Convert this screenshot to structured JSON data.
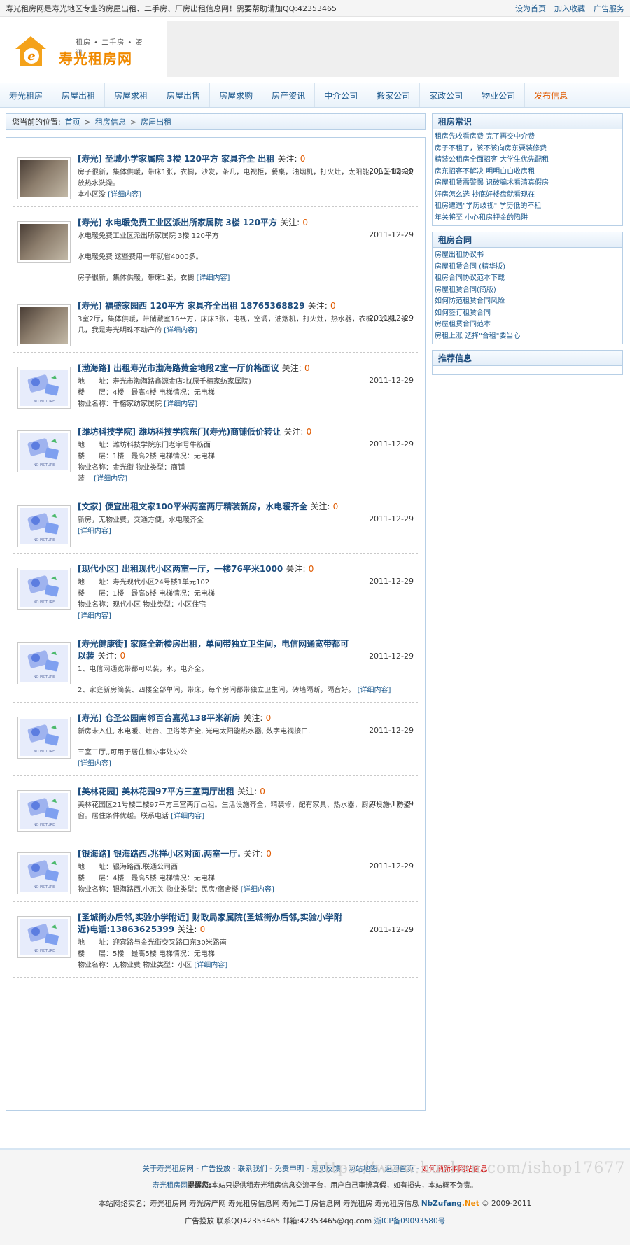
{
  "topbar": {
    "intro": "寿光租房网是寿光地区专业的房屋出租、二手房、厂房出租信息网！需要帮助请加QQ:42353465",
    "links": [
      "设为首页",
      "加入收藏",
      "广告服务"
    ]
  },
  "logo": {
    "tags": "租房 • 二手房 • 资讯",
    "name": "寿光租房网"
  },
  "nav": [
    "寿光租房",
    "房屋出租",
    "房屋求租",
    "房屋出售",
    "房屋求购",
    "房产资讯",
    "中介公司",
    "搬家公司",
    "家政公司",
    "物业公司",
    "发布信息"
  ],
  "breadcrumb": {
    "prefix": "您当前的位置:",
    "items": [
      "首页",
      "租房信息",
      "房屋出租"
    ],
    "sep": ">"
  },
  "follow_label": "关注:",
  "more_label": "[详细内容]",
  "listings": [
    {
      "area": "[寿光]",
      "title": "圣城小学家属院 3楼 120平方 家具齐全 出租",
      "count": "0",
      "date": "2011-12-29",
      "photo": true,
      "lines": [
        "房子很新，集体供暖，带床1张，衣橱，沙发，茶几，电视柜，餐桌，油烟机，打火灶，太阳能，小区1周2次放热水洗澡。",
        "本小区没"
      ]
    },
    {
      "area": "[寿光]",
      "title": "水电暖免费工业区派出所家属院 3楼 120平方",
      "count": "0",
      "date": "2011-12-29",
      "photo": true,
      "lines": [
        "水电暖免费工业区派出所家属院 3楼 120平方",
        "水电暖免费 这些费用一年就省4000多。",
        "房子很新，集体供暖，带床1张，衣橱"
      ]
    },
    {
      "area": "[寿光]",
      "title": "福盛家园西 120平方 家具齐全出租 18765368829",
      "count": "0",
      "date": "2011-12-29",
      "photo": true,
      "lines": [
        "3室2厅，集体供暖，带储藏室16平方，床床3张，电视，空调，油烟机，打火灶，热水器，衣橱，沙发，茶几，我是寿光明珠不动产的"
      ]
    },
    {
      "area": "[渤海路]",
      "title": "出租寿光市渤海路黄金地段2室一厅价格面议",
      "count": "0",
      "date": "2011-12-29",
      "photo": false,
      "lines": [
        "地　　址：寿光市渤海路鑫源金店北(原千榕家纺家属院)",
        "楼　　层：4楼　最高4楼 电梯情况：无电梯",
        "物业名称：千榕家纺家属院"
      ]
    },
    {
      "area": "[潍坊科技学院]",
      "title": "潍坊科技学院东门(寿光)商铺低价转让",
      "count": "0",
      "date": "2011-12-29",
      "photo": false,
      "lines": [
        "地　　址：潍坊科技学院东门老字号牛筋面",
        "楼　　层：1楼　最高2楼 电梯情况：无电梯",
        "物业名称：金光街 物业类型：商铺",
        "装　"
      ]
    },
    {
      "area": "[文家]",
      "title": "便宜出租文家100平米两室两厅精装新房，水电暖齐全",
      "count": "0",
      "date": "2011-12-29",
      "photo": false,
      "lines": [
        "新房，无物业费，交通方便，水电暖齐全",
        ""
      ]
    },
    {
      "area": "[现代小区]",
      "title": "出租现代小区两室一厅，一楼76平米1000",
      "count": "0",
      "date": "2011-12-29",
      "photo": false,
      "lines": [
        "地　　址：寿光现代小区24号楼1单元102",
        "楼　　层：1楼　最高6楼 电梯情况：无电梯",
        "物业名称：现代小区 物业类型：小区住宅",
        ""
      ]
    },
    {
      "area": "[寿光健康街]",
      "title": "家庭全新楼房出租，单间带独立卫生间，电信网通宽带都可以装",
      "count": "0",
      "date": "2011-12-29",
      "photo": false,
      "lines": [
        "1、电信网通宽带都可以装，水，电齐全。",
        "2、家庭新房简装、四楼全部单间，带床，每个房间都带独立卫生间，砖墙隔断，隔音好。"
      ]
    },
    {
      "area": "[寿光]",
      "title": "仓圣公园南邻百合嘉苑138平米新房",
      "count": "0",
      "date": "2011-12-29",
      "photo": false,
      "lines": [
        "新房未入住, 水电暖、灶台、卫浴等齐全, 光电太阳能热水器, 数字电视接口.",
        "三室二厅,,可用于居住和办事处办公",
        ""
      ]
    },
    {
      "area": "[美林花园]",
      "title": "美林花园97平方三室两厅出租",
      "count": "0",
      "date": "2011-12-29",
      "photo": false,
      "lines": [
        "美林花园区21号楼二楼97平方三室两厅出租。生活设施齐全，精装修，配有家具、热水器，厨房设施，防盗窗。居住条件优越。联系电话"
      ]
    },
    {
      "area": "[银海路]",
      "title": "银海路西.兆祥小区对面.两室一厅.",
      "count": "0",
      "date": "2011-12-29",
      "photo": false,
      "lines": [
        "地　　址：银海路西.联通公司西",
        "楼　　层：4楼　最高5楼 电梯情况：无电梯",
        "物业名称：银海路西.小东关 物业类型：民房/宿舍楼"
      ]
    },
    {
      "area": "[圣城街办后邻,实验小学附近]",
      "title": "财政局家属院(圣城街办后邻,实验小学附近)电话:13863625399",
      "count": "0",
      "date": "2011-12-29",
      "photo": false,
      "lines": [
        "地　　址：迎宾路与金光街交叉路口东30米路南",
        "楼　　层：5楼　最高5楼 电梯情况：无电梯",
        "物业名称：无物业费 物业类型：小区"
      ]
    }
  ],
  "sidebar": {
    "tips": {
      "title": "租房常识",
      "items": [
        "租房先收看房费 完了再交中介费",
        "房子不租了，该不该向房东要装修费",
        "精装公租房全面招客 大学生优先配租",
        "房东招客不解决 明明白白收房租",
        "房屋租赁需警惕 识破骗术看清真假房",
        "好房怎么选 抄底好楼盘就看现在",
        "租房遭遇\"学历歧视\" 学历低的不租",
        "年关将至 小心租房押金的陷阱"
      ]
    },
    "contracts": {
      "title": "租房合同",
      "items": [
        "房屋出租协议书",
        "房屋租赁合同 (精华版)",
        "租房合同协议范本下载",
        "房屋租赁合同(简版)",
        "如何防范租赁合同风险",
        "如何签订租赁合同",
        "房屋租赁合同范本",
        "房租上涨 选择\"合租\"要当心"
      ]
    },
    "recommend": {
      "title": "推荐信息"
    }
  },
  "footer": {
    "links": [
      "关于寿光租房网",
      "广告投放",
      "联系我们",
      "免责申明",
      "意见反馈",
      "网站地图",
      "返回首页"
    ],
    "sep": " - ",
    "red": "如何刷新本网站信息",
    "notice_brand": "寿光租房网",
    "notice_label": "提醒您:",
    "notice": "本站只提供租寿光租房信息交流平台，用户自己审辨真假，如有损失，本站概不负责。",
    "names_prefix": "本站网络实名：",
    "names": "寿光租房网 寿光房产网 寿光租房信息网 寿光二手房信息网 寿光租房 寿光租房信息",
    "brand_a": "NbZufang",
    "brand_b": ".Net",
    "copyright": "© 2009-2011",
    "contact": "广告投放 联系QQ42353465 邮箱:42353465@qq.com",
    "icp": "浙ICP备09093580号"
  },
  "watermark": "https://www.huzhan.com/ishop17677",
  "colors": {
    "link": "#1d5a8e",
    "title": "#1d4d7e",
    "accent": "#f08a00",
    "count": "#e05a00",
    "border": "#b7cfe6"
  }
}
